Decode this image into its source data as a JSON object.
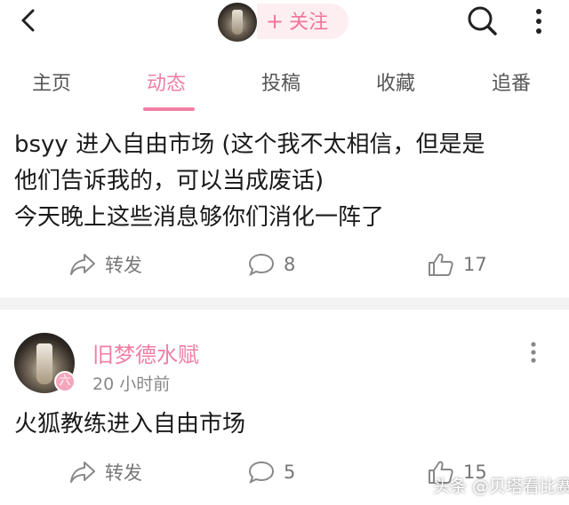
{
  "header": {
    "follow_label": "关注",
    "follow_plus": "+"
  },
  "tabs": [
    {
      "label": "主页",
      "active": false
    },
    {
      "label": "动态",
      "active": true
    },
    {
      "label": "投稿",
      "active": false
    },
    {
      "label": "收藏",
      "active": false
    },
    {
      "label": "追番",
      "active": false
    }
  ],
  "post1": {
    "lines": [
      "bsyy 进入自由市场 (这个我不太相信，但是是",
      "他们告诉我的，可以当成废话)",
      "今天晚上这些消息够你们消化一阵了"
    ],
    "share_label": "转发",
    "comments": "8",
    "likes": "17"
  },
  "post2": {
    "author": "旧梦德水赋",
    "badge": "六",
    "time": "20 小时前",
    "text": "火狐教练进入自由市场",
    "share_label": "转发",
    "comments": "5",
    "likes": "15"
  },
  "watermark": "头条 @贝塔看比赛",
  "colors": {
    "accent": "#f07fa3",
    "follow_bg": "#fdeef2",
    "divider": "#f3f3f3"
  }
}
